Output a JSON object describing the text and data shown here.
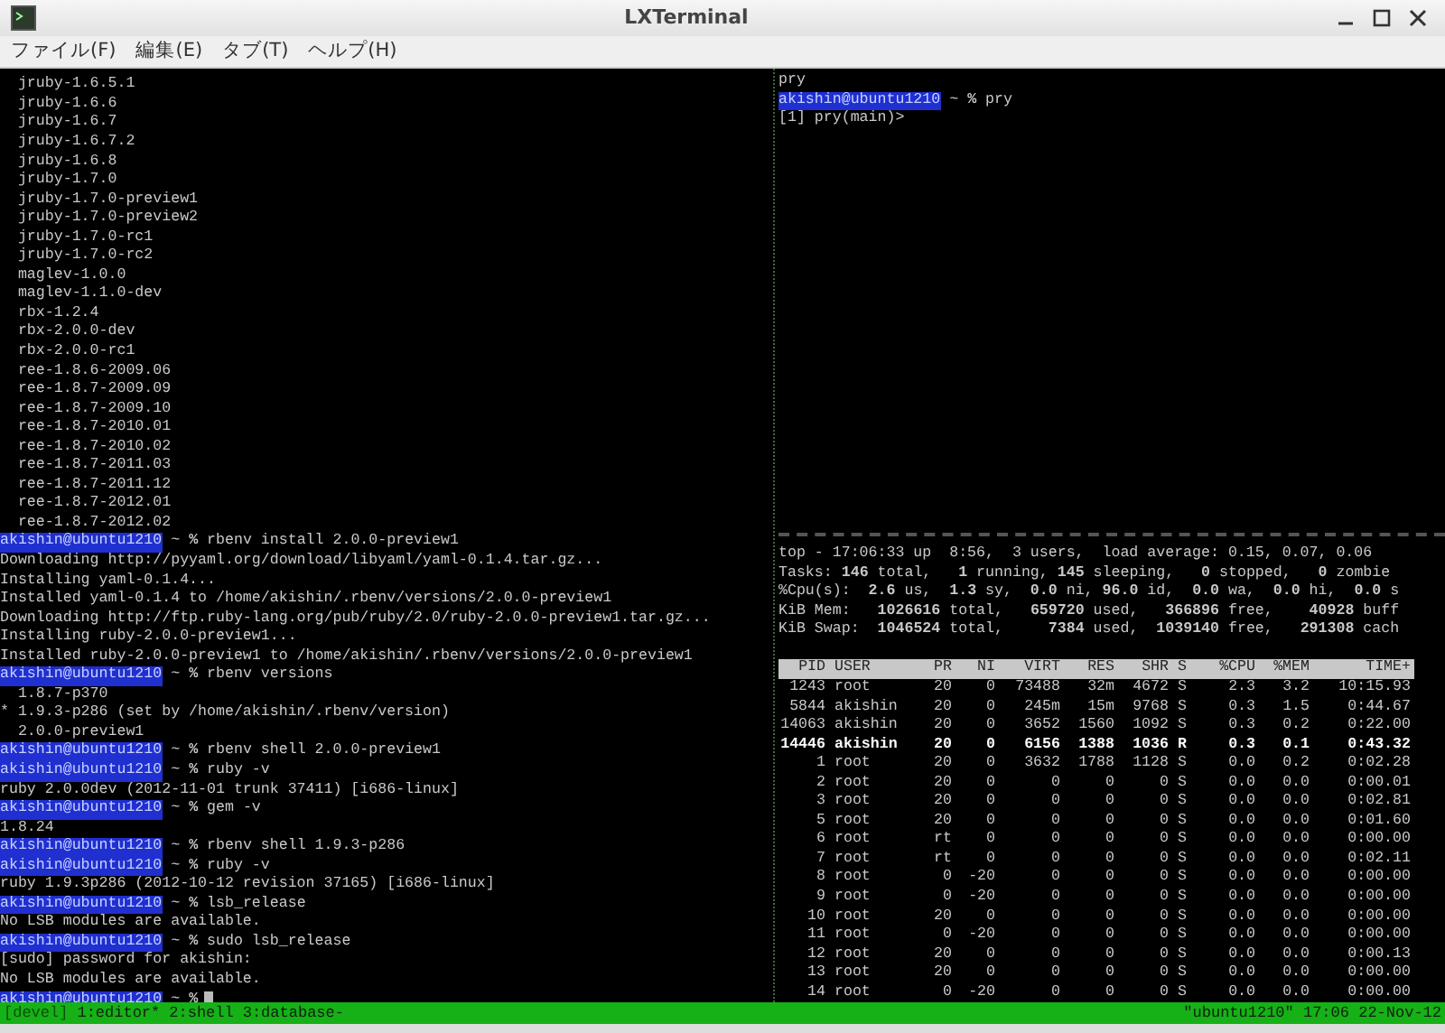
{
  "window": {
    "title": "LXTerminal"
  },
  "menu": [
    "ファイル(F)",
    "編集(E)",
    "タブ(T)",
    "ヘルプ(H)"
  ],
  "left_pane": {
    "cursor": true,
    "lines": [
      {
        "kind": "output",
        "text": "  jruby-1.6.5.1"
      },
      {
        "kind": "output",
        "text": "  jruby-1.6.6"
      },
      {
        "kind": "output",
        "text": "  jruby-1.6.7"
      },
      {
        "kind": "output",
        "text": "  jruby-1.6.7.2"
      },
      {
        "kind": "output",
        "text": "  jruby-1.6.8"
      },
      {
        "kind": "output",
        "text": "  jruby-1.7.0"
      },
      {
        "kind": "output",
        "text": "  jruby-1.7.0-preview1"
      },
      {
        "kind": "output",
        "text": "  jruby-1.7.0-preview2"
      },
      {
        "kind": "output",
        "text": "  jruby-1.7.0-rc1"
      },
      {
        "kind": "output",
        "text": "  jruby-1.7.0-rc2"
      },
      {
        "kind": "output",
        "text": "  maglev-1.0.0"
      },
      {
        "kind": "output",
        "text": "  maglev-1.1.0-dev"
      },
      {
        "kind": "output",
        "text": "  rbx-1.2.4"
      },
      {
        "kind": "output",
        "text": "  rbx-2.0.0-dev"
      },
      {
        "kind": "output",
        "text": "  rbx-2.0.0-rc1"
      },
      {
        "kind": "output",
        "text": "  ree-1.8.6-2009.06"
      },
      {
        "kind": "output",
        "text": "  ree-1.8.7-2009.09"
      },
      {
        "kind": "output",
        "text": "  ree-1.8.7-2009.10"
      },
      {
        "kind": "output",
        "text": "  ree-1.8.7-2010.01"
      },
      {
        "kind": "output",
        "text": "  ree-1.8.7-2010.02"
      },
      {
        "kind": "output",
        "text": "  ree-1.8.7-2011.03"
      },
      {
        "kind": "output",
        "text": "  ree-1.8.7-2011.12"
      },
      {
        "kind": "output",
        "text": "  ree-1.8.7-2012.01"
      },
      {
        "kind": "output",
        "text": "  ree-1.8.7-2012.02"
      },
      {
        "kind": "prompt",
        "user": "akishin@ubuntu1210",
        "text": " ~ **%** rbenv install 2.0.0-preview1"
      },
      {
        "kind": "output",
        "text": "Downloading http://pyyaml.org/download/libyaml/yaml-0.1.4.tar.gz..."
      },
      {
        "kind": "output",
        "text": "Installing yaml-0.1.4..."
      },
      {
        "kind": "output",
        "text": "Installed yaml-0.1.4 to /home/akishin/.rbenv/versions/2.0.0-preview1"
      },
      {
        "kind": "output",
        "text": "Downloading http://ftp.ruby-lang.org/pub/ruby/2.0/ruby-2.0.0-preview1.tar.gz..."
      },
      {
        "kind": "output",
        "text": "Installing ruby-2.0.0-preview1..."
      },
      {
        "kind": "output",
        "text": "Installed ruby-2.0.0-preview1 to /home/akishin/.rbenv/versions/2.0.0-preview1"
      },
      {
        "kind": "prompt",
        "user": "akishin@ubuntu1210",
        "text": " ~ **%** rbenv versions"
      },
      {
        "kind": "output",
        "text": "  1.8.7-p370"
      },
      {
        "kind": "output",
        "text": "* 1.9.3-p286 (set by /home/akishin/.rbenv/version)"
      },
      {
        "kind": "output",
        "text": "  2.0.0-preview1"
      },
      {
        "kind": "prompt",
        "user": "akishin@ubuntu1210",
        "text": " ~ **%** rbenv shell 2.0.0-preview1"
      },
      {
        "kind": "prompt",
        "user": "akishin@ubuntu1210",
        "text": " ~ **%** ruby -v"
      },
      {
        "kind": "output",
        "text": "ruby 2.0.0dev (2012-11-01 trunk 37411) [i686-linux]"
      },
      {
        "kind": "prompt",
        "user": "akishin@ubuntu1210",
        "text": " ~ **%** gem -v"
      },
      {
        "kind": "output",
        "text": "1.8.24"
      },
      {
        "kind": "prompt",
        "user": "akishin@ubuntu1210",
        "text": " ~ **%** rbenv shell 1.9.3-p286"
      },
      {
        "kind": "prompt",
        "user": "akishin@ubuntu1210",
        "text": " ~ **%** ruby -v"
      },
      {
        "kind": "output",
        "text": "ruby 1.9.3p286 (2012-10-12 revision 37165) [i686-linux]"
      },
      {
        "kind": "prompt",
        "user": "akishin@ubuntu1210",
        "text": " ~ **%** lsb_release"
      },
      {
        "kind": "output",
        "text": "No LSB modules are available."
      },
      {
        "kind": "prompt",
        "user": "akishin@ubuntu1210",
        "text": " ~ **%** sudo lsb_release"
      },
      {
        "kind": "output",
        "text": "[sudo] password for akishin:"
      },
      {
        "kind": "output",
        "text": "No LSB modules are available."
      },
      {
        "kind": "prompt",
        "user": "akishin@ubuntu1210",
        "text": " ~ **%**"
      }
    ]
  },
  "pry_pane": {
    "lines": [
      {
        "kind": "output",
        "text": "pry"
      },
      {
        "kind": "prompt",
        "user": "akishin@ubuntu1210",
        "text": " ~ **%** pry"
      },
      {
        "kind": "output",
        "text": "[1] pry(main)>"
      }
    ]
  },
  "top_pane": {
    "summary": [
      "top - 17:06:33 up  8:56,  3 users,  load average: 0.15, 0.07, 0.06",
      "Tasks: **146** total,   **1** running, **145** sleeping,   **0** stopped,   **0** zombie",
      "%Cpu(s):  **2.6** us,  **1.3** sy,  **0.0** ni, **96.0** id,  **0.0** wa,  **0.0** hi,  **0.0** s",
      "KiB Mem:   **1026616** total,   **659720** used,   **366896** free,    **40928** buff",
      "KiB Swap:  **1046524** total,     **7384** used,  **1039140** free,   **291308** cach"
    ],
    "columns": [
      "PID",
      "USER",
      "PR",
      "NI",
      "VIRT",
      "RES",
      "SHR",
      "S",
      "%CPU",
      "%MEM",
      "TIME+"
    ],
    "rows": [
      {
        "highlighted": false,
        "cells": [
          "1243",
          "root",
          "20",
          "0",
          "73488",
          "32m",
          "4672",
          "S",
          "2.3",
          "3.2",
          "10:15.93"
        ]
      },
      {
        "highlighted": false,
        "cells": [
          "5844",
          "akishin",
          "20",
          "0",
          "245m",
          "15m",
          "9768",
          "S",
          "0.3",
          "1.5",
          "0:44.67"
        ]
      },
      {
        "highlighted": false,
        "cells": [
          "14063",
          "akishin",
          "20",
          "0",
          "3652",
          "1560",
          "1092",
          "S",
          "0.3",
          "0.2",
          "0:22.00"
        ]
      },
      {
        "highlighted": true,
        "cells": [
          "14446",
          "akishin",
          "20",
          "0",
          "6156",
          "1388",
          "1036",
          "R",
          "0.3",
          "0.1",
          "0:43.32"
        ]
      },
      {
        "highlighted": false,
        "cells": [
          "1",
          "root",
          "20",
          "0",
          "3632",
          "1788",
          "1128",
          "S",
          "0.0",
          "0.2",
          "0:02.28"
        ]
      },
      {
        "highlighted": false,
        "cells": [
          "2",
          "root",
          "20",
          "0",
          "0",
          "0",
          "0",
          "S",
          "0.0",
          "0.0",
          "0:00.01"
        ]
      },
      {
        "highlighted": false,
        "cells": [
          "3",
          "root",
          "20",
          "0",
          "0",
          "0",
          "0",
          "S",
          "0.0",
          "0.0",
          "0:02.81"
        ]
      },
      {
        "highlighted": false,
        "cells": [
          "5",
          "root",
          "20",
          "0",
          "0",
          "0",
          "0",
          "S",
          "0.0",
          "0.0",
          "0:01.60"
        ]
      },
      {
        "highlighted": false,
        "cells": [
          "6",
          "root",
          "rt",
          "0",
          "0",
          "0",
          "0",
          "S",
          "0.0",
          "0.0",
          "0:00.00"
        ]
      },
      {
        "highlighted": false,
        "cells": [
          "7",
          "root",
          "rt",
          "0",
          "0",
          "0",
          "0",
          "S",
          "0.0",
          "0.0",
          "0:02.11"
        ]
      },
      {
        "highlighted": false,
        "cells": [
          "8",
          "root",
          "0",
          "-20",
          "0",
          "0",
          "0",
          "S",
          "0.0",
          "0.0",
          "0:00.00"
        ]
      },
      {
        "highlighted": false,
        "cells": [
          "9",
          "root",
          "0",
          "-20",
          "0",
          "0",
          "0",
          "S",
          "0.0",
          "0.0",
          "0:00.00"
        ]
      },
      {
        "highlighted": false,
        "cells": [
          "10",
          "root",
          "20",
          "0",
          "0",
          "0",
          "0",
          "S",
          "0.0",
          "0.0",
          "0:00.00"
        ]
      },
      {
        "highlighted": false,
        "cells": [
          "11",
          "root",
          "0",
          "-20",
          "0",
          "0",
          "0",
          "S",
          "0.0",
          "0.0",
          "0:00.00"
        ]
      },
      {
        "highlighted": false,
        "cells": [
          "12",
          "root",
          "20",
          "0",
          "0",
          "0",
          "0",
          "S",
          "0.0",
          "0.0",
          "0:00.13"
        ]
      },
      {
        "highlighted": false,
        "cells": [
          "13",
          "root",
          "20",
          "0",
          "0",
          "0",
          "0",
          "S",
          "0.0",
          "0.0",
          "0:00.00"
        ]
      },
      {
        "highlighted": false,
        "cells": [
          "14",
          "root",
          "0",
          "-20",
          "0",
          "0",
          "0",
          "S",
          "0.0",
          "0.0",
          "0:00.00"
        ]
      }
    ]
  },
  "status_bar": {
    "session": "[devel]",
    "windows": [
      "1:editor*",
      "2:shell",
      "3:database-"
    ],
    "right": "\"ubuntu1210\" 17:06 22-Nov-12"
  }
}
